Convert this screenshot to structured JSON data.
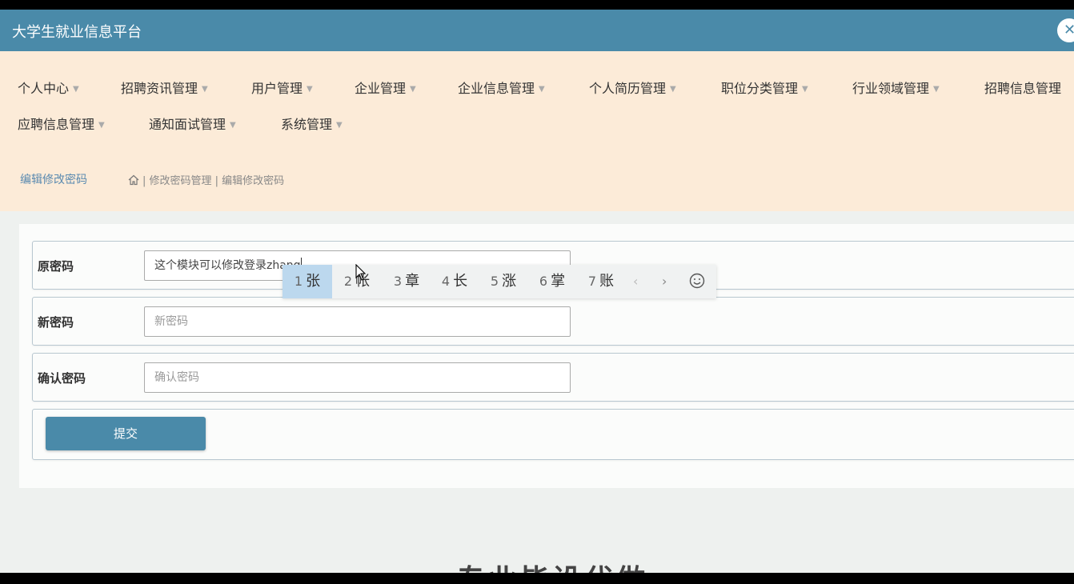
{
  "header": {
    "title": "大学生就业信息平台",
    "close_label": "✕"
  },
  "menu": {
    "items": [
      {
        "label": "个人中心"
      },
      {
        "label": "招聘资讯管理"
      },
      {
        "label": "用户管理"
      },
      {
        "label": "企业管理"
      },
      {
        "label": "企业信息管理"
      },
      {
        "label": "个人简历管理"
      },
      {
        "label": "职位分类管理"
      },
      {
        "label": "行业领域管理"
      },
      {
        "label": "招聘信息管理"
      },
      {
        "label": "应聘信息管理"
      },
      {
        "label": "通知面试管理"
      },
      {
        "label": "系统管理"
      }
    ]
  },
  "breadcrumb": {
    "page_title": "编辑修改密码",
    "path": "| 修改密码管理 | 编辑修改密码"
  },
  "form": {
    "old_password": {
      "label": "原密码",
      "value": "这个模块可以修改登录zhang"
    },
    "new_password": {
      "label": "新密码",
      "placeholder": "新密码"
    },
    "confirm_password": {
      "label": "确认密码",
      "placeholder": "确认密码"
    },
    "submit_label": "提交"
  },
  "ime": {
    "candidates": [
      {
        "num": "1",
        "char": "张"
      },
      {
        "num": "2",
        "char": "帐"
      },
      {
        "num": "3",
        "char": "章"
      },
      {
        "num": "4",
        "char": "长"
      },
      {
        "num": "5",
        "char": "涨"
      },
      {
        "num": "6",
        "char": "掌"
      },
      {
        "num": "7",
        "char": "账"
      }
    ],
    "prev_label": "‹",
    "next_label": "›"
  },
  "footer": {
    "partial_text": "专业毕设代做"
  },
  "colors": {
    "header_bg": "#4a8aa9",
    "nav_bg": "#fcebd8",
    "accent": "#4a8aa9"
  }
}
